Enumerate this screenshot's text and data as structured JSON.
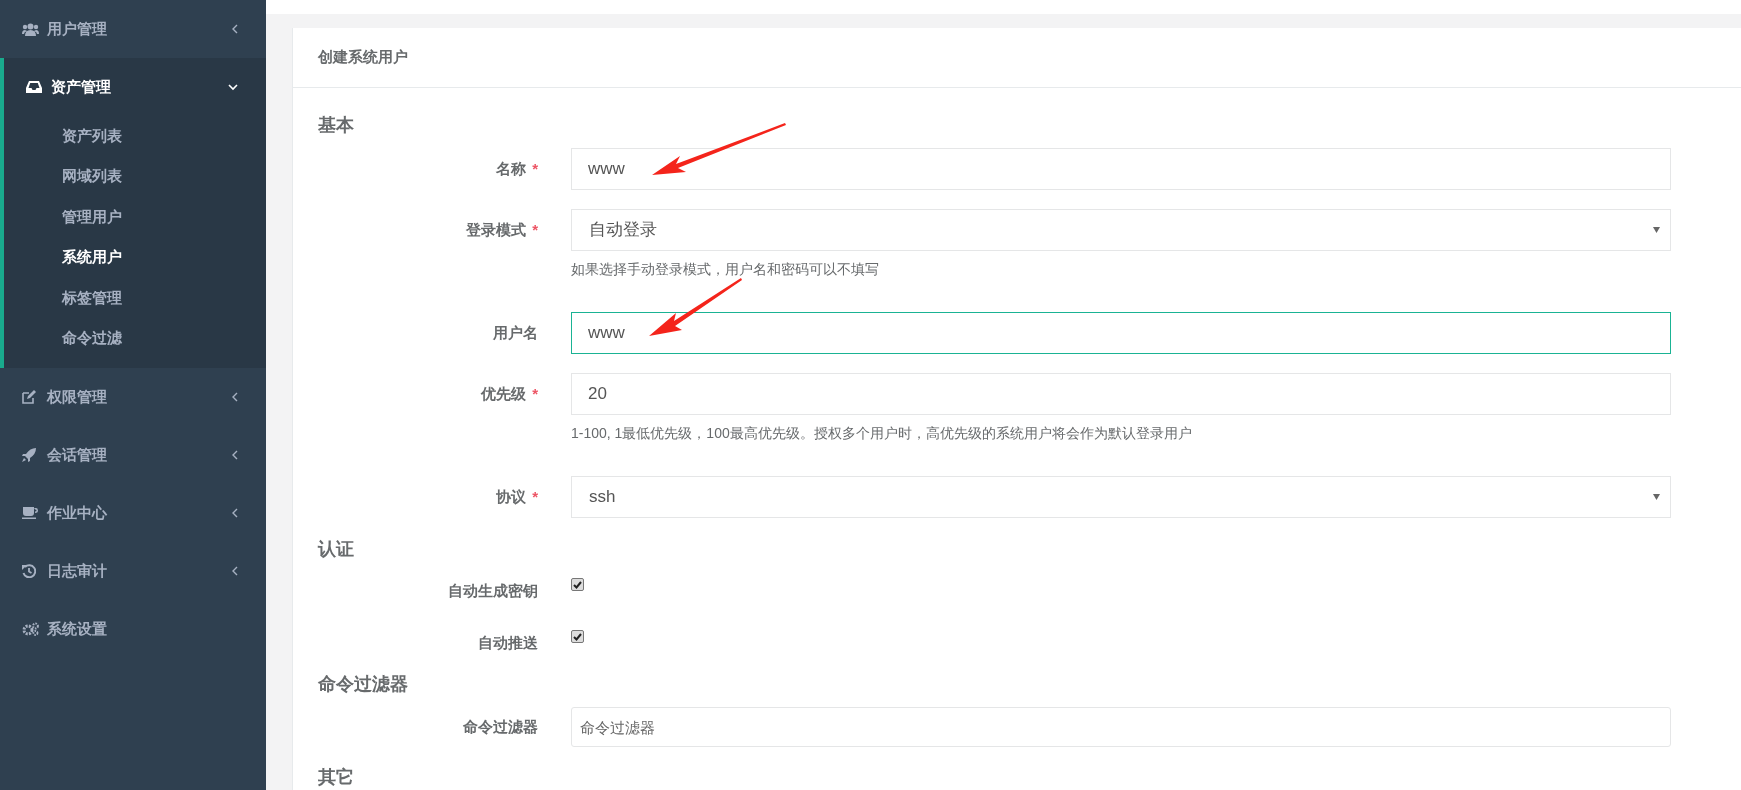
{
  "sidebar": {
    "items": [
      {
        "label": "用户管理",
        "expanded": false,
        "has_submenu": true
      },
      {
        "label": "资产管理",
        "expanded": true,
        "has_submenu": true,
        "children": [
          {
            "label": "资产列表",
            "selected": false
          },
          {
            "label": "网域列表",
            "selected": false
          },
          {
            "label": "管理用户",
            "selected": false
          },
          {
            "label": "系统用户",
            "selected": true
          },
          {
            "label": "标签管理",
            "selected": false
          },
          {
            "label": "命令过滤",
            "selected": false
          }
        ]
      },
      {
        "label": "权限管理",
        "expanded": false,
        "has_submenu": true
      },
      {
        "label": "会话管理",
        "expanded": false,
        "has_submenu": true
      },
      {
        "label": "作业中心",
        "expanded": false,
        "has_submenu": true
      },
      {
        "label": "日志审计",
        "expanded": false,
        "has_submenu": true
      },
      {
        "label": "系统设置",
        "expanded": false,
        "has_submenu": false
      }
    ]
  },
  "card": {
    "title": "创建系统用户"
  },
  "sections": [
    {
      "heading": "基本",
      "fields": [
        {
          "kind": "text",
          "label": "名称",
          "required_mark": "*",
          "value": "www",
          "focused": false
        },
        {
          "kind": "select",
          "label": "登录模式",
          "required_mark": "*",
          "value": "自动登录",
          "help": "如果选择手动登录模式，用户名和密码可以不填写"
        },
        {
          "kind": "text",
          "label": "用户名",
          "value": "www",
          "focused": true
        },
        {
          "kind": "text",
          "label": "优先级",
          "required_mark": "*",
          "value": "20",
          "focused": false,
          "help": "1-100, 1最低优先级，100最高优先级。授权多个用户时，高优先级的系统用户将会作为默认登录用户"
        },
        {
          "kind": "select",
          "label": "协议",
          "required_mark": "*",
          "value": "ssh"
        }
      ]
    },
    {
      "heading": "认证",
      "fields": [
        {
          "kind": "checkbox",
          "label": "自动生成密钥",
          "checked": true
        },
        {
          "kind": "checkbox",
          "label": "自动推送",
          "checked": true
        }
      ]
    },
    {
      "heading": "命令过滤器",
      "fields": [
        {
          "kind": "multi",
          "label": "命令过滤器",
          "placeholder": "命令过滤器"
        }
      ]
    },
    {
      "heading": "其它"
    }
  ]
}
